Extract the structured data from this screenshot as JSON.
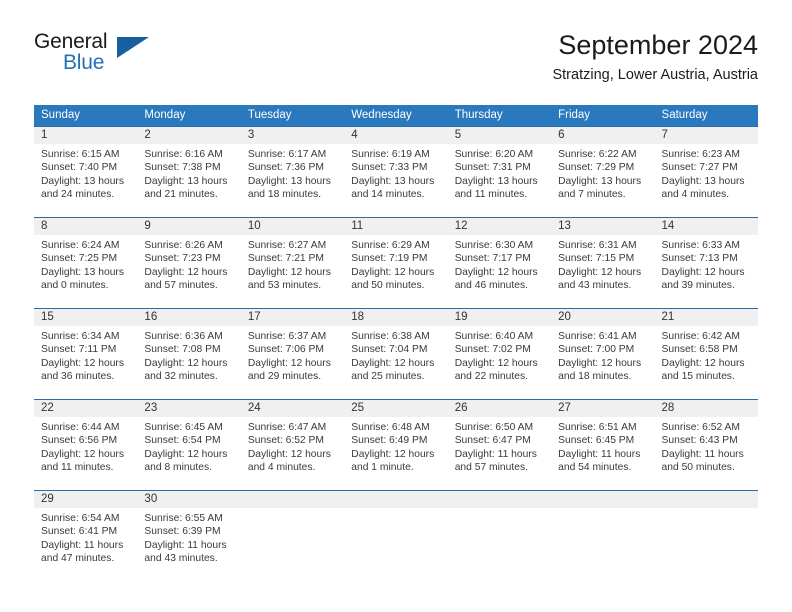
{
  "brand": {
    "name_top": "General",
    "name_bottom": "Blue",
    "accent_color": "#2272b9",
    "triangle_color": "#17609f"
  },
  "header": {
    "title": "September 2024",
    "subtitle": "Stratzing, Lower Austria, Austria"
  },
  "calendar": {
    "header_bg": "#2a78bd",
    "daynum_bg": "#f0f0f0",
    "divider_color": "#2a6ca8",
    "weekdays": [
      "Sunday",
      "Monday",
      "Tuesday",
      "Wednesday",
      "Thursday",
      "Friday",
      "Saturday"
    ],
    "weeks": [
      [
        {
          "day": "1",
          "sunrise": "Sunrise: 6:15 AM",
          "sunset": "Sunset: 7:40 PM",
          "daylight_1": "Daylight: 13 hours",
          "daylight_2": "and 24 minutes."
        },
        {
          "day": "2",
          "sunrise": "Sunrise: 6:16 AM",
          "sunset": "Sunset: 7:38 PM",
          "daylight_1": "Daylight: 13 hours",
          "daylight_2": "and 21 minutes."
        },
        {
          "day": "3",
          "sunrise": "Sunrise: 6:17 AM",
          "sunset": "Sunset: 7:36 PM",
          "daylight_1": "Daylight: 13 hours",
          "daylight_2": "and 18 minutes."
        },
        {
          "day": "4",
          "sunrise": "Sunrise: 6:19 AM",
          "sunset": "Sunset: 7:33 PM",
          "daylight_1": "Daylight: 13 hours",
          "daylight_2": "and 14 minutes."
        },
        {
          "day": "5",
          "sunrise": "Sunrise: 6:20 AM",
          "sunset": "Sunset: 7:31 PM",
          "daylight_1": "Daylight: 13 hours",
          "daylight_2": "and 11 minutes."
        },
        {
          "day": "6",
          "sunrise": "Sunrise: 6:22 AM",
          "sunset": "Sunset: 7:29 PM",
          "daylight_1": "Daylight: 13 hours",
          "daylight_2": "and 7 minutes."
        },
        {
          "day": "7",
          "sunrise": "Sunrise: 6:23 AM",
          "sunset": "Sunset: 7:27 PM",
          "daylight_1": "Daylight: 13 hours",
          "daylight_2": "and 4 minutes."
        }
      ],
      [
        {
          "day": "8",
          "sunrise": "Sunrise: 6:24 AM",
          "sunset": "Sunset: 7:25 PM",
          "daylight_1": "Daylight: 13 hours",
          "daylight_2": "and 0 minutes."
        },
        {
          "day": "9",
          "sunrise": "Sunrise: 6:26 AM",
          "sunset": "Sunset: 7:23 PM",
          "daylight_1": "Daylight: 12 hours",
          "daylight_2": "and 57 minutes."
        },
        {
          "day": "10",
          "sunrise": "Sunrise: 6:27 AM",
          "sunset": "Sunset: 7:21 PM",
          "daylight_1": "Daylight: 12 hours",
          "daylight_2": "and 53 minutes."
        },
        {
          "day": "11",
          "sunrise": "Sunrise: 6:29 AM",
          "sunset": "Sunset: 7:19 PM",
          "daylight_1": "Daylight: 12 hours",
          "daylight_2": "and 50 minutes."
        },
        {
          "day": "12",
          "sunrise": "Sunrise: 6:30 AM",
          "sunset": "Sunset: 7:17 PM",
          "daylight_1": "Daylight: 12 hours",
          "daylight_2": "and 46 minutes."
        },
        {
          "day": "13",
          "sunrise": "Sunrise: 6:31 AM",
          "sunset": "Sunset: 7:15 PM",
          "daylight_1": "Daylight: 12 hours",
          "daylight_2": "and 43 minutes."
        },
        {
          "day": "14",
          "sunrise": "Sunrise: 6:33 AM",
          "sunset": "Sunset: 7:13 PM",
          "daylight_1": "Daylight: 12 hours",
          "daylight_2": "and 39 minutes."
        }
      ],
      [
        {
          "day": "15",
          "sunrise": "Sunrise: 6:34 AM",
          "sunset": "Sunset: 7:11 PM",
          "daylight_1": "Daylight: 12 hours",
          "daylight_2": "and 36 minutes."
        },
        {
          "day": "16",
          "sunrise": "Sunrise: 6:36 AM",
          "sunset": "Sunset: 7:08 PM",
          "daylight_1": "Daylight: 12 hours",
          "daylight_2": "and 32 minutes."
        },
        {
          "day": "17",
          "sunrise": "Sunrise: 6:37 AM",
          "sunset": "Sunset: 7:06 PM",
          "daylight_1": "Daylight: 12 hours",
          "daylight_2": "and 29 minutes."
        },
        {
          "day": "18",
          "sunrise": "Sunrise: 6:38 AM",
          "sunset": "Sunset: 7:04 PM",
          "daylight_1": "Daylight: 12 hours",
          "daylight_2": "and 25 minutes."
        },
        {
          "day": "19",
          "sunrise": "Sunrise: 6:40 AM",
          "sunset": "Sunset: 7:02 PM",
          "daylight_1": "Daylight: 12 hours",
          "daylight_2": "and 22 minutes."
        },
        {
          "day": "20",
          "sunrise": "Sunrise: 6:41 AM",
          "sunset": "Sunset: 7:00 PM",
          "daylight_1": "Daylight: 12 hours",
          "daylight_2": "and 18 minutes."
        },
        {
          "day": "21",
          "sunrise": "Sunrise: 6:42 AM",
          "sunset": "Sunset: 6:58 PM",
          "daylight_1": "Daylight: 12 hours",
          "daylight_2": "and 15 minutes."
        }
      ],
      [
        {
          "day": "22",
          "sunrise": "Sunrise: 6:44 AM",
          "sunset": "Sunset: 6:56 PM",
          "daylight_1": "Daylight: 12 hours",
          "daylight_2": "and 11 minutes."
        },
        {
          "day": "23",
          "sunrise": "Sunrise: 6:45 AM",
          "sunset": "Sunset: 6:54 PM",
          "daylight_1": "Daylight: 12 hours",
          "daylight_2": "and 8 minutes."
        },
        {
          "day": "24",
          "sunrise": "Sunrise: 6:47 AM",
          "sunset": "Sunset: 6:52 PM",
          "daylight_1": "Daylight: 12 hours",
          "daylight_2": "and 4 minutes."
        },
        {
          "day": "25",
          "sunrise": "Sunrise: 6:48 AM",
          "sunset": "Sunset: 6:49 PM",
          "daylight_1": "Daylight: 12 hours",
          "daylight_2": "and 1 minute."
        },
        {
          "day": "26",
          "sunrise": "Sunrise: 6:50 AM",
          "sunset": "Sunset: 6:47 PM",
          "daylight_1": "Daylight: 11 hours",
          "daylight_2": "and 57 minutes."
        },
        {
          "day": "27",
          "sunrise": "Sunrise: 6:51 AM",
          "sunset": "Sunset: 6:45 PM",
          "daylight_1": "Daylight: 11 hours",
          "daylight_2": "and 54 minutes."
        },
        {
          "day": "28",
          "sunrise": "Sunrise: 6:52 AM",
          "sunset": "Sunset: 6:43 PM",
          "daylight_1": "Daylight: 11 hours",
          "daylight_2": "and 50 minutes."
        }
      ],
      [
        {
          "day": "29",
          "sunrise": "Sunrise: 6:54 AM",
          "sunset": "Sunset: 6:41 PM",
          "daylight_1": "Daylight: 11 hours",
          "daylight_2": "and 47 minutes."
        },
        {
          "day": "30",
          "sunrise": "Sunrise: 6:55 AM",
          "sunset": "Sunset: 6:39 PM",
          "daylight_1": "Daylight: 11 hours",
          "daylight_2": "and 43 minutes."
        },
        {
          "day": "",
          "sunrise": "",
          "sunset": "",
          "daylight_1": "",
          "daylight_2": ""
        },
        {
          "day": "",
          "sunrise": "",
          "sunset": "",
          "daylight_1": "",
          "daylight_2": ""
        },
        {
          "day": "",
          "sunrise": "",
          "sunset": "",
          "daylight_1": "",
          "daylight_2": ""
        },
        {
          "day": "",
          "sunrise": "",
          "sunset": "",
          "daylight_1": "",
          "daylight_2": ""
        },
        {
          "day": "",
          "sunrise": "",
          "sunset": "",
          "daylight_1": "",
          "daylight_2": ""
        }
      ]
    ]
  }
}
